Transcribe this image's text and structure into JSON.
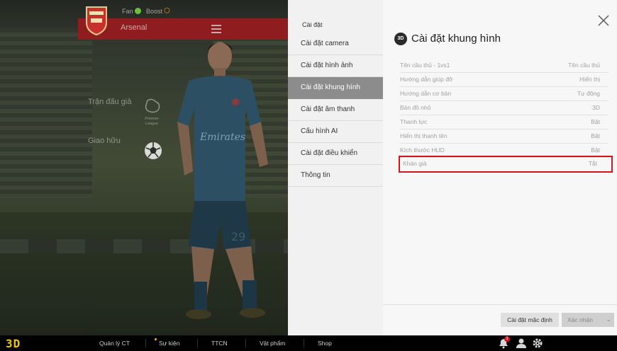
{
  "top_bar": {
    "fan_label": "Fan",
    "boost_label": "Boost",
    "club_name": "Arsenal"
  },
  "left_menu": {
    "items": [
      "Trận đấu giả",
      "Giao hữu"
    ],
    "league_name": "Premier League"
  },
  "settings_sidebar": {
    "header": "Cài đặt",
    "items": [
      {
        "label": "Cài đặt camera",
        "active": false
      },
      {
        "label": "Cài đặt hình ảnh",
        "active": false
      },
      {
        "label": "Cài đặt khung hình",
        "active": true
      },
      {
        "label": "Cài đặt âm thanh",
        "active": false
      },
      {
        "label": "Cấu hình AI",
        "active": false
      },
      {
        "label": "Cài đặt điều khiển",
        "active": false
      },
      {
        "label": "Thông tin",
        "active": false
      }
    ]
  },
  "main_panel": {
    "title": "Cài đặt khung hình",
    "title_icon_text": "3D",
    "rows": [
      {
        "label": "Tên cầu thủ - 1vs1",
        "value": "Tên cầu thủ"
      },
      {
        "label": "Hướng dẫn giúp đỡ",
        "value": "Hiển thị"
      },
      {
        "label": "Hướng dẫn cơ bản",
        "value": "Tự động"
      },
      {
        "label": "Bản đồ nhỏ",
        "value": "3D"
      },
      {
        "label": "Thanh lực",
        "value": "Bật"
      },
      {
        "label": "Hiển thị thanh tên",
        "value": "Bật"
      },
      {
        "label": "Kích thước HUD",
        "value": "Bật"
      },
      {
        "label": "Khán giả",
        "value": "Tắt"
      }
    ],
    "highlighted_row": 7,
    "default_button": "Cài đặt mặc định",
    "confirm_button": "Xác nhận"
  },
  "bottom_bar": {
    "logo": "3D",
    "items": [
      "Quản lý CT",
      "Sự kiện",
      "TTCN",
      "Vật phẩm",
      "Shop"
    ],
    "notification_count": "1",
    "icons": [
      "bell-icon",
      "user-icon",
      "gear-icon"
    ]
  },
  "colors": {
    "club_red": "#8f1d1f",
    "highlight_red": "#d3161e",
    "sidebar_active": "#8c8c8c",
    "logo_yellow": "#f2c400"
  }
}
